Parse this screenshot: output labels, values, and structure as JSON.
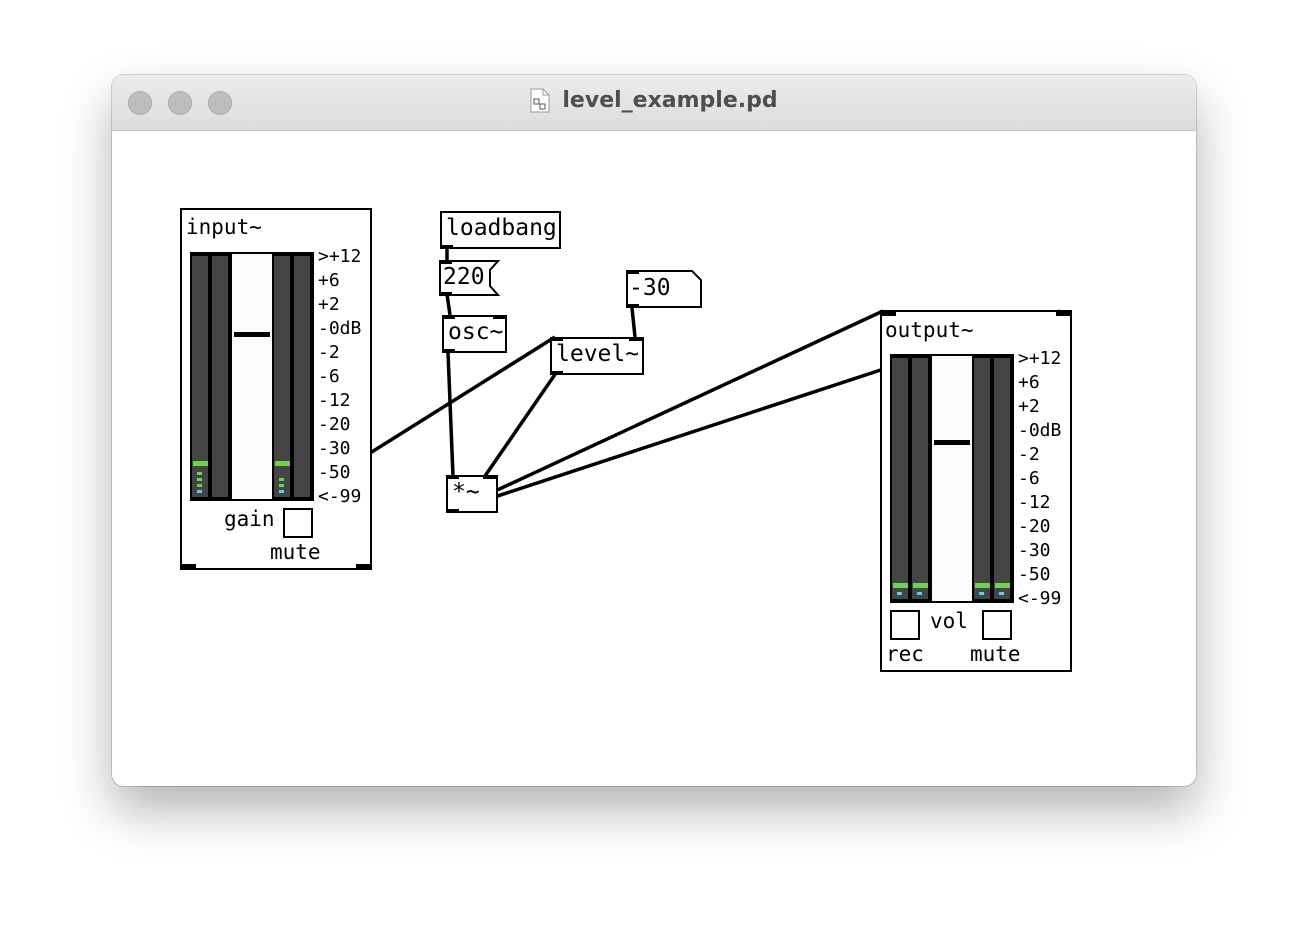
{
  "window": {
    "title": "level_example.pd",
    "icon": "pd-file-icon",
    "controls": [
      "close",
      "minimize",
      "zoom"
    ]
  },
  "patch": {
    "objects": {
      "loadbang": "loadbang",
      "msg_220": "220",
      "osc": "osc~",
      "level": "level~",
      "num_minus30": "-30",
      "mult": "*~"
    },
    "input_abs": {
      "title": "input~",
      "gain_label": "gain",
      "mute_label": "mute"
    },
    "output_abs": {
      "title": "output~",
      "vol_label": "vol",
      "rec_label": "rec",
      "mute_label": "mute"
    },
    "vu_scale": [
      ">+12",
      "+6",
      "+2",
      "-0dB",
      "-2",
      "-6",
      "-12",
      "-20",
      "-30",
      "-50",
      "<-99"
    ]
  },
  "colors": {
    "meter_green": "#6cd44a",
    "meter_cyan": "#4fd6e6",
    "meter_gray": "#444444"
  }
}
